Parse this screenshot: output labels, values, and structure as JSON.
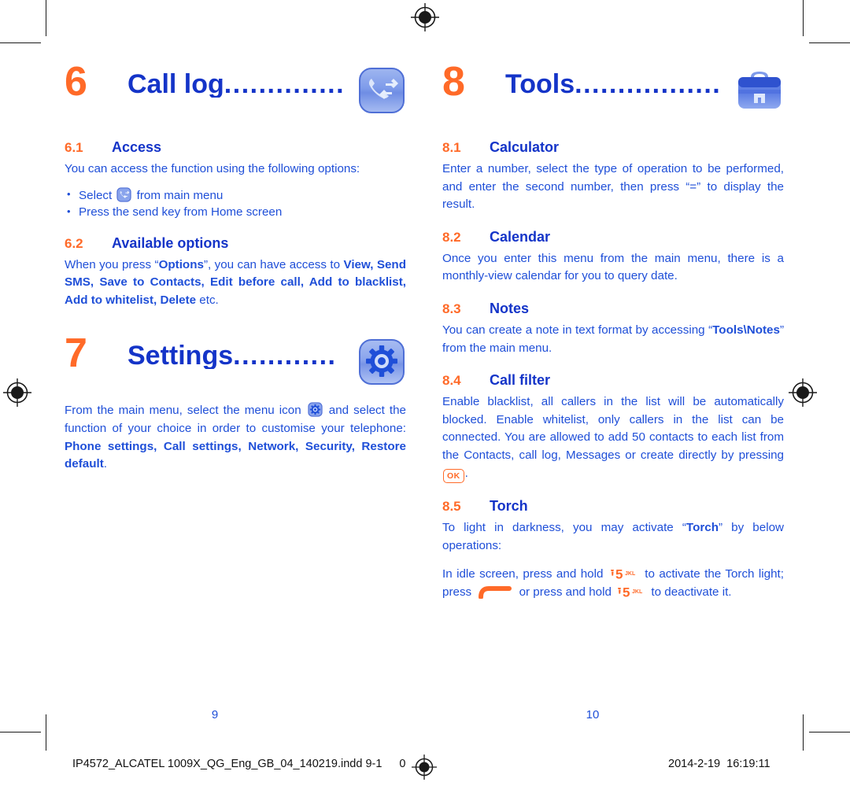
{
  "document": {
    "type": "print-proof-spread",
    "colors": {
      "heading_blue": "#1434c8",
      "body_blue": "#1f4fd8",
      "accent_orange": "#ff6a28",
      "footer_black": "#111111",
      "page_background": "#ffffff"
    }
  },
  "left_page": {
    "page_number": "9",
    "chapter": {
      "number": "6",
      "title": "Call log",
      "dots": "..............",
      "icon": "call-log-icon"
    },
    "sections": [
      {
        "number": "6.1",
        "title": "Access",
        "intro": "You can access the function using the following options:",
        "bullets": [
          {
            "before": "Select ",
            "icon": "call-log-small-icon",
            "after": " from main menu"
          },
          {
            "before": "Press the send key from Home screen",
            "icon": null,
            "after": ""
          }
        ]
      },
      {
        "number": "6.2",
        "title": "Available options",
        "paragraph_parts": {
          "p1": "When you press “",
          "b1": "Options",
          "p2": "”, you can have access to ",
          "b2": "View, Send SMS, Save to Contacts, Edit before call, Add to blacklist, Add to whitelist, Delete",
          "p3": " etc."
        }
      }
    ],
    "chapter2": {
      "number": "7",
      "title": "Settings",
      "dots": "............",
      "icon": "settings-gear-icon",
      "paragraph_parts": {
        "p1": "From the main menu, select the menu icon ",
        "icon": "settings-small-icon",
        "p2": " and select the function of your choice in order to customise your telephone: ",
        "b1": "Phone settings, Call settings, Network, Security, Restore default",
        "p3": "."
      }
    }
  },
  "right_page": {
    "page_number": "10",
    "chapter": {
      "number": "8",
      "title": "Tools",
      "dots": ".................",
      "icon": "toolbox-icon"
    },
    "sections": [
      {
        "number": "8.1",
        "title": "Calculator",
        "paragraph": "Enter a number, select the type of operation to be performed, and enter the second number, then press “=” to display the result."
      },
      {
        "number": "8.2",
        "title": "Calendar",
        "paragraph": "Once you enter this menu from the main menu, there is a monthly-view calendar for you to query date."
      },
      {
        "number": "8.3",
        "title": "Notes",
        "paragraph_parts": {
          "p1": "You can create a note in text format by accessing “",
          "b1": "Tools\\Notes",
          "p2": "” from the main menu."
        }
      },
      {
        "number": "8.4",
        "title": "Call filter",
        "paragraph_parts": {
          "p1": "Enable blacklist, all callers in the list will be automatically blocked. Enable whitelist, only callers in the list can be connected. You are allowed to add 50 contacts to each list from the Contacts, call log, Messages or create directly by pressing ",
          "key": "OK",
          "p2": "."
        }
      },
      {
        "number": "8.5",
        "title": "Torch",
        "paragraph_parts": {
          "p1": "To light in darkness, you may activate “",
          "b1": "Torch",
          "p2": "” by below operations:"
        },
        "paragraph2_parts": {
          "p1": "In idle screen, press and hold ",
          "key1": "5-jkl-key-icon",
          "p2": " to activate the Torch light; press ",
          "key2": "end-call-key-icon",
          "p3": " or press and hold ",
          "key3": "5-jkl-key-icon",
          "p4": " to deactivate it."
        },
        "key_labels": {
          "five": "5",
          "jkl": "JKL",
          "ok": "OK"
        }
      }
    ]
  },
  "footer": {
    "file_name_left": "IP4572_ALCATEL 1009X_QG_Eng_GB_04_140219.indd",
    "page_range_left": "9-1",
    "page_range_right": "0",
    "date": "2014-2-19",
    "time": "16:19:11"
  }
}
